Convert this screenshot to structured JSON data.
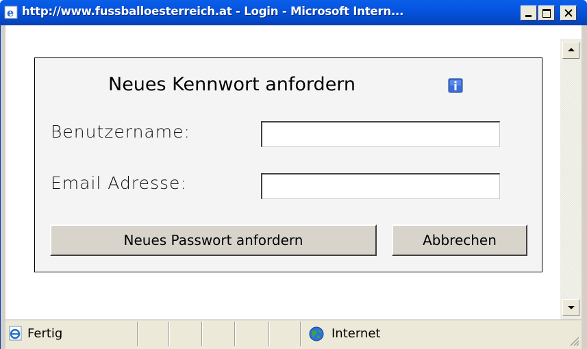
{
  "window": {
    "title": "http://www.fussballoesterreich.at - Login - Microsoft Intern...",
    "title_bar_color": "#0554e0"
  },
  "form": {
    "heading": "Neues Kennwort anfordern",
    "info_icon": "info-icon",
    "username_label": "Benutzername:",
    "username_value": "",
    "email_label": "Email Adresse:",
    "email_value": "",
    "request_button_label": "Neues Passwort anfordern",
    "cancel_button_label": "Abbrechen",
    "panel_background": "#f4f4f4"
  },
  "statusbar": {
    "status_text": "Fertig",
    "status_icon": "ie-page-icon",
    "zone_text": "Internet",
    "zone_icon": "globe-icon"
  }
}
